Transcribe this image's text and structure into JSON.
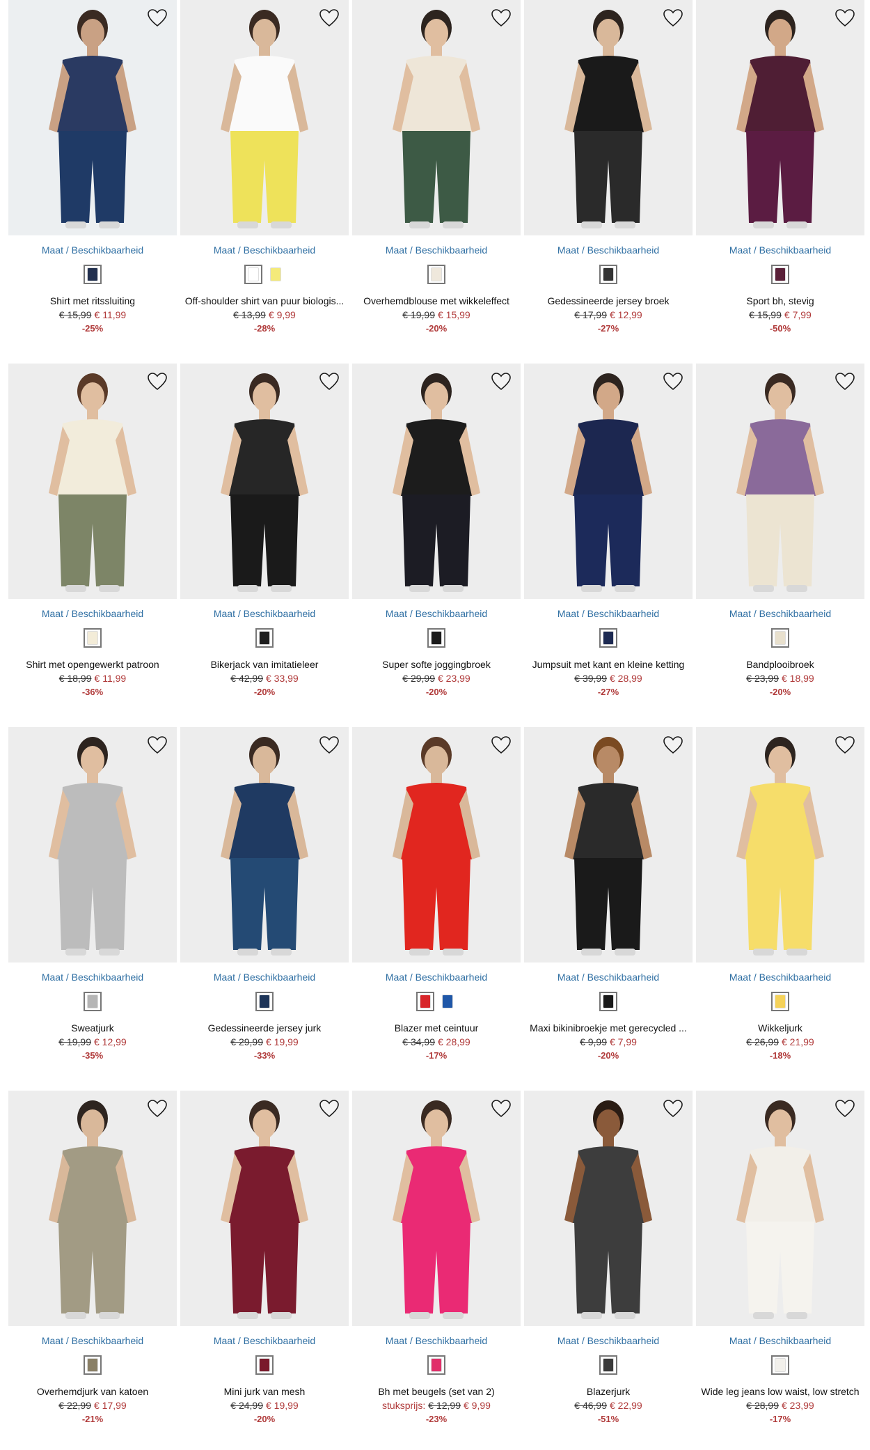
{
  "size_link_label": "Maat / Beschikbaarheid",
  "products": [
    {
      "name": "Shirt met ritssluiting",
      "old_price": "€ 15,99",
      "new_price": "€ 11,99",
      "discount": "-25%",
      "swatches": [
        "#22304f"
      ],
      "photo": {
        "bg": "#eceff1",
        "top": "#2a3a62",
        "bottom": "#1f3a66",
        "skin": "#c9a184",
        "hair": "#3a2a22"
      }
    },
    {
      "name": "Off-shoulder shirt van puur biologis...",
      "old_price": "€ 13,99",
      "new_price": "€ 9,99",
      "discount": "-28%",
      "swatches": [
        "#ffffff",
        "#f4ea7a"
      ],
      "photo": {
        "bg": "#ededed",
        "top": "#fafafa",
        "bottom": "#eee25a",
        "skin": "#d9b89a",
        "hair": "#3a2a22"
      }
    },
    {
      "name": "Overhemdblouse met wikkeleffect",
      "old_price": "€ 19,99",
      "new_price": "€ 15,99",
      "discount": "-20%",
      "swatches": [
        "#efe8dc"
      ],
      "photo": {
        "bg": "#ededed",
        "top": "#eee6d8",
        "bottom": "#3d5a45",
        "skin": "#e0bea0",
        "hair": "#2d241f"
      }
    },
    {
      "name": "Gedessineerde jersey broek",
      "old_price": "€ 17,99",
      "new_price": "€ 12,99",
      "discount": "-27%",
      "swatches": [
        "#333333"
      ],
      "photo": {
        "bg": "#ededed",
        "top": "#1a1a1a",
        "bottom": "#2a2a2a",
        "skin": "#d9b89a",
        "hair": "#2d241f"
      }
    },
    {
      "name": "Sport bh, stevig",
      "old_price": "€ 15,99",
      "new_price": "€ 7,99",
      "discount": "-50%",
      "swatches": [
        "#5a2038"
      ],
      "photo": {
        "bg": "#ededed",
        "top": "#4f1e34",
        "bottom": "#5b1c42",
        "skin": "#d2a888",
        "hair": "#2d241f"
      }
    },
    {
      "name": "Shirt met opengewerkt patroon",
      "old_price": "€ 18,99",
      "new_price": "€ 11,99",
      "discount": "-36%",
      "swatches": [
        "#f3ecd8"
      ],
      "photo": {
        "bg": "#ededed",
        "top": "#f2ecdb",
        "bottom": "#7d8567",
        "skin": "#e0bea0",
        "hair": "#5a3a28"
      }
    },
    {
      "name": "Bikerjack van imitatieleer",
      "old_price": "€ 42,99",
      "new_price": "€ 33,99",
      "discount": "-20%",
      "swatches": [
        "#1e1e1e"
      ],
      "photo": {
        "bg": "#ededed",
        "top": "#262626",
        "bottom": "#1a1a1a",
        "skin": "#e0bea0",
        "hair": "#3a2a22"
      }
    },
    {
      "name": "Super softe joggingbroek",
      "old_price": "€ 29,99",
      "new_price": "€ 23,99",
      "discount": "-20%",
      "swatches": [
        "#1a1a1a"
      ],
      "photo": {
        "bg": "#ededed",
        "top": "#1c1c1c",
        "bottom": "#1c1c24",
        "skin": "#e0bea0",
        "hair": "#2d241f"
      }
    },
    {
      "name": "Jumpsuit met kant en kleine ketting",
      "old_price": "€ 39,99",
      "new_price": "€ 28,99",
      "discount": "-27%",
      "swatches": [
        "#1d2a52"
      ],
      "photo": {
        "bg": "#ededed",
        "top": "#1c2750",
        "bottom": "#1c2a5a",
        "skin": "#d2a888",
        "hair": "#2d241f"
      }
    },
    {
      "name": "Bandplooibroek",
      "old_price": "€ 23,99",
      "new_price": "€ 18,99",
      "discount": "-20%",
      "swatches": [
        "#e8e0cd"
      ],
      "photo": {
        "bg": "#ededed",
        "top": "#8a6a9a",
        "bottom": "#ece4d2",
        "skin": "#e0bea0",
        "hair": "#3a2a22"
      }
    },
    {
      "name": "Sweatjurk",
      "old_price": "€ 19,99",
      "new_price": "€ 12,99",
      "discount": "-35%",
      "swatches": [
        "#b5b5b5"
      ],
      "photo": {
        "bg": "#ededed",
        "top": "#bcbcbc",
        "bottom": "#bcbcbc",
        "skin": "#e0bea0",
        "hair": "#2d241f"
      }
    },
    {
      "name": "Gedessineerde jersey jurk",
      "old_price": "€ 29,99",
      "new_price": "€ 19,99",
      "discount": "-33%",
      "swatches": [
        "#1d3458"
      ],
      "photo": {
        "bg": "#ededed",
        "top": "#1f3a62",
        "bottom": "#244a74",
        "skin": "#d9b89a",
        "hair": "#3a2a22"
      }
    },
    {
      "name": "Blazer met ceintuur",
      "old_price": "€ 34,99",
      "new_price": "€ 28,99",
      "discount": "-17%",
      "swatches": [
        "#d8262a",
        "#1f57a8"
      ],
      "photo": {
        "bg": "#ededed",
        "top": "#e1261f",
        "bottom": "#e1261f",
        "skin": "#d9b89a",
        "hair": "#5a3a28"
      }
    },
    {
      "name": "Maxi bikinibroekje met gerecycled ...",
      "old_price": "€ 9,99",
      "new_price": "€ 7,99",
      "discount": "-20%",
      "swatches": [
        "#1a1a1a"
      ],
      "photo": {
        "bg": "#ededed",
        "top": "#2a2a2a",
        "bottom": "#1a1a1a",
        "skin": "#b88a66",
        "hair": "#7a4a22"
      }
    },
    {
      "name": "Wikkeljurk",
      "old_price": "€ 26,99",
      "new_price": "€ 21,99",
      "discount": "-18%",
      "swatches": [
        "#f5d25a"
      ],
      "photo": {
        "bg": "#ededed",
        "top": "#f6dd6a",
        "bottom": "#f6dd6a",
        "skin": "#e0bea0",
        "hair": "#2d241f"
      }
    },
    {
      "name": "Overhemdjurk van katoen",
      "old_price": "€ 22,99",
      "new_price": "€ 17,99",
      "discount": "-21%",
      "swatches": [
        "#8a8066"
      ],
      "photo": {
        "bg": "#ededed",
        "top": "#a29b84",
        "bottom": "#a29b84",
        "skin": "#d9b89a",
        "hair": "#2d241f"
      }
    },
    {
      "name": "Mini jurk van mesh",
      "old_price": "€ 24,99",
      "new_price": "€ 19,99",
      "discount": "-20%",
      "swatches": [
        "#7a1a2c"
      ],
      "photo": {
        "bg": "#ededed",
        "top": "#7a1b2e",
        "bottom": "#7a1b2e",
        "skin": "#e0bea0",
        "hair": "#3a2a22"
      }
    },
    {
      "name": "Bh met beugels (set van 2)",
      "prefix": "stuksprijs:",
      "old_price": "€ 12,99",
      "new_price": "€ 9,99",
      "discount": "-23%",
      "swatches": [
        "#e12f6a"
      ],
      "photo": {
        "bg": "#ededed",
        "top": "#ea2a74",
        "bottom": "#ea2a74",
        "skin": "#e0bea0",
        "hair": "#3a2a22"
      }
    },
    {
      "name": "Blazerjurk",
      "old_price": "€ 46,99",
      "new_price": "€ 22,99",
      "discount": "-51%",
      "swatches": [
        "#3a3a3a"
      ],
      "photo": {
        "bg": "#ededed",
        "top": "#3d3d3d",
        "bottom": "#3d3d3d",
        "skin": "#8a5a3a",
        "hair": "#2a1c14"
      }
    },
    {
      "name": "Wide leg jeans low waist, low stretch",
      "old_price": "€ 28,99",
      "new_price": "€ 23,99",
      "discount": "-17%",
      "swatches": [
        "#f2f0eb"
      ],
      "photo": {
        "bg": "#ededed",
        "top": "#f2efe9",
        "bottom": "#f5f3ee",
        "skin": "#e0bea0",
        "hair": "#3a2a22"
      }
    }
  ]
}
